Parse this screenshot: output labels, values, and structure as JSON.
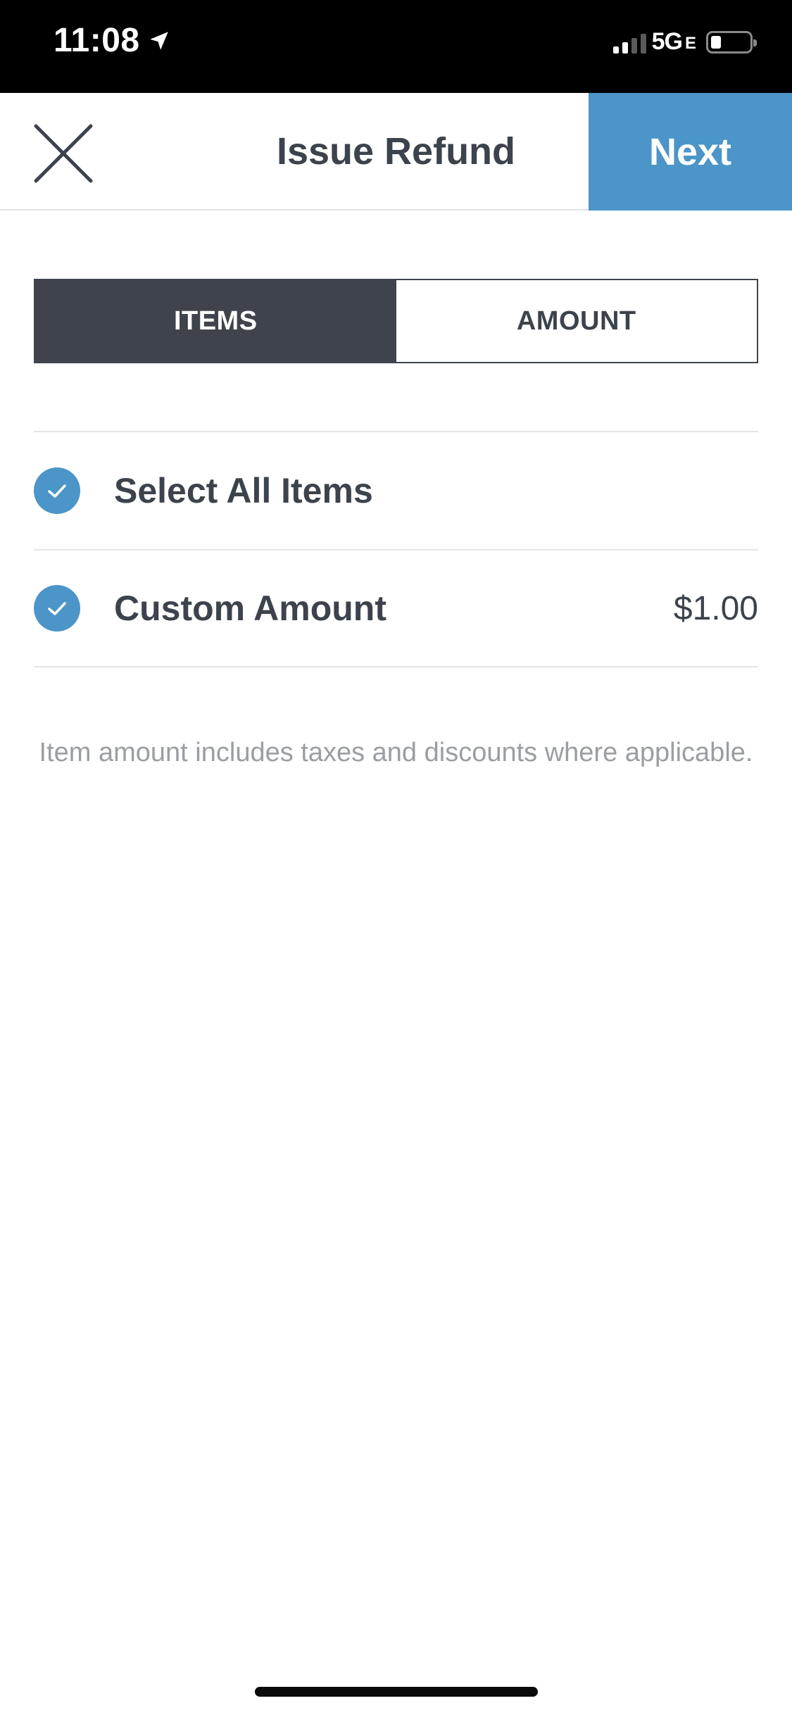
{
  "status_bar": {
    "time": "11:08",
    "network": "5G",
    "network_suffix": "E",
    "location_icon": "location-arrow-icon",
    "signal_icon": "cell-signal-icon",
    "battery_icon": "battery-low-icon"
  },
  "header": {
    "title": "Issue Refund",
    "next_label": "Next",
    "close_icon": "close-icon",
    "accent_color": "#4b95c8"
  },
  "tabs": [
    {
      "label": "ITEMS",
      "active": true
    },
    {
      "label": "AMOUNT",
      "active": false
    }
  ],
  "items": [
    {
      "label": "Select All Items",
      "checked": true,
      "price": ""
    },
    {
      "label": "Custom Amount",
      "checked": true,
      "price": "$1.00"
    }
  ],
  "note": "Item amount includes taxes and discounts where applicable."
}
